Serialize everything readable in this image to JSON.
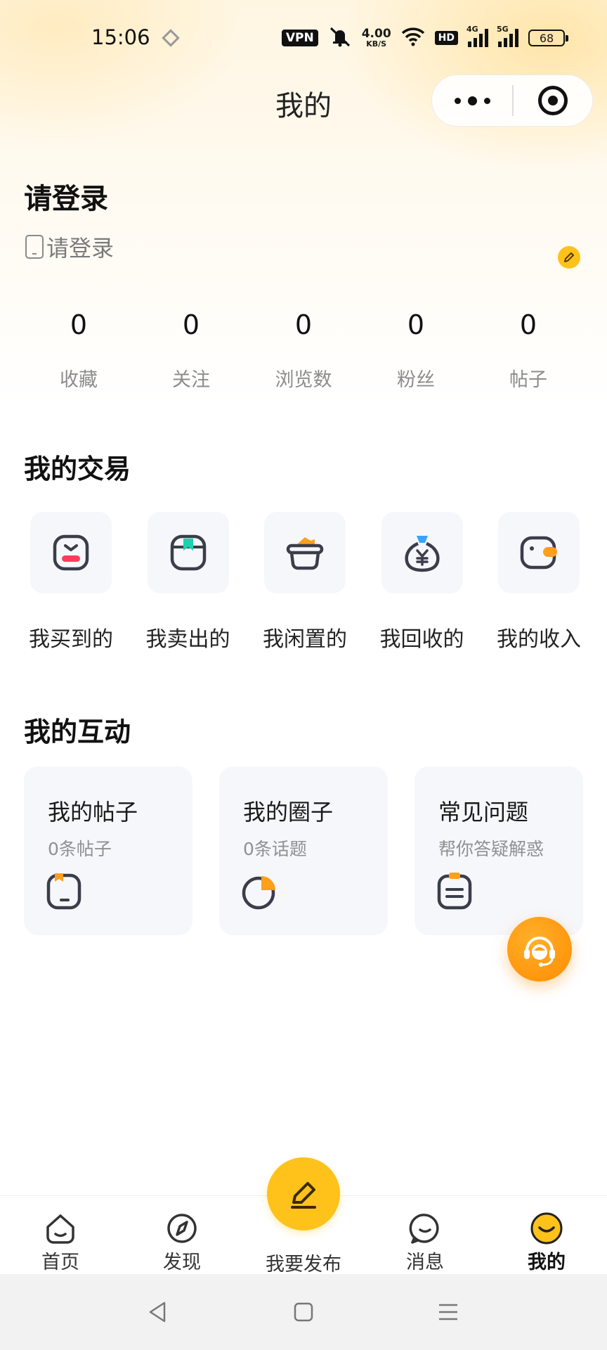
{
  "status_bar": {
    "time": "15:06",
    "vpn": "VPN",
    "net_speed_value": "4.00",
    "net_speed_unit": "KB/S",
    "hd": "HD",
    "signal_1": "4G",
    "signal_2": "5G",
    "battery": "68"
  },
  "header": {
    "title": "我的"
  },
  "profile": {
    "login_title": "请登录",
    "login_subtitle": "请登录"
  },
  "stats": [
    {
      "value": "0",
      "label": "收藏"
    },
    {
      "value": "0",
      "label": "关注"
    },
    {
      "value": "0",
      "label": "浏览数"
    },
    {
      "value": "0",
      "label": "粉丝"
    },
    {
      "value": "0",
      "label": "帖子"
    }
  ],
  "trade": {
    "title": "我的交易",
    "items": [
      {
        "label": "我买到的",
        "icon": "bought-icon"
      },
      {
        "label": "我卖出的",
        "icon": "sold-icon"
      },
      {
        "label": "我闲置的",
        "icon": "idle-basket-icon"
      },
      {
        "label": "我回收的",
        "icon": "recycle-moneybag-icon"
      },
      {
        "label": "我的收入",
        "icon": "wallet-icon"
      }
    ]
  },
  "interaction": {
    "title": "我的互动",
    "cards": [
      {
        "title": "我的帖子",
        "subtitle": "0条帖子",
        "icon": "post-icon"
      },
      {
        "title": "我的圈子",
        "subtitle": "0条话题",
        "icon": "circle-icon"
      },
      {
        "title": "常见问题",
        "subtitle": "帮你答疑解惑",
        "icon": "faq-icon"
      }
    ]
  },
  "tabbar": {
    "home": "首页",
    "discover": "发现",
    "publish": "我要发布",
    "messages": "消息",
    "mine": "我的"
  },
  "colors": {
    "accent": "#ffc21a",
    "accent_orange": "#ff9f1a",
    "tile_bg": "#f6f7fb",
    "icon_stroke": "#3a3d4a",
    "teal": "#1fd1b0",
    "blue": "#3aa3ff",
    "red": "#ff3b5c"
  }
}
